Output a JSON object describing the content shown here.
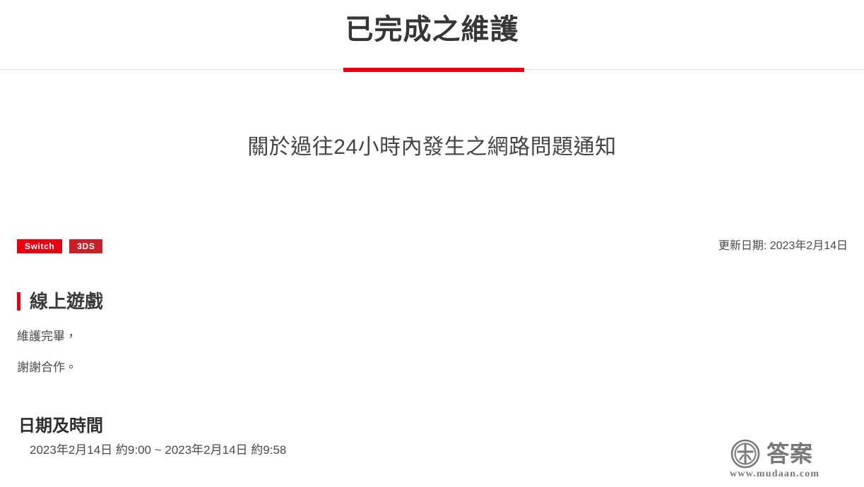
{
  "header": {
    "title": "已完成之維護",
    "accent_color": "#e60012",
    "rule_color": "#e4e4e4"
  },
  "subtitle": "關於過往24小時內發生之網路問題通知",
  "meta": {
    "tags": [
      {
        "label": "Switch",
        "color": "#e60012",
        "name": "tag-switch"
      },
      {
        "label": "3DS",
        "color": "#c8202a",
        "name": "tag-3ds"
      }
    ],
    "updated_label": "更新日期: 2023年2月14日"
  },
  "sections": {
    "online": {
      "heading": "線上遊戲",
      "accent_color": "#e60012",
      "lines": [
        "維護完畢，",
        "謝謝合作。"
      ]
    },
    "datetime": {
      "heading": "日期及時間",
      "value": "2023年2月14日 約9:00 ~ 2023年2月14日 約9:58"
    }
  },
  "watermark": {
    "mark_text": "答案",
    "url": "www.mudaan.com",
    "logo_icon": "circle-cross-logo-icon"
  }
}
